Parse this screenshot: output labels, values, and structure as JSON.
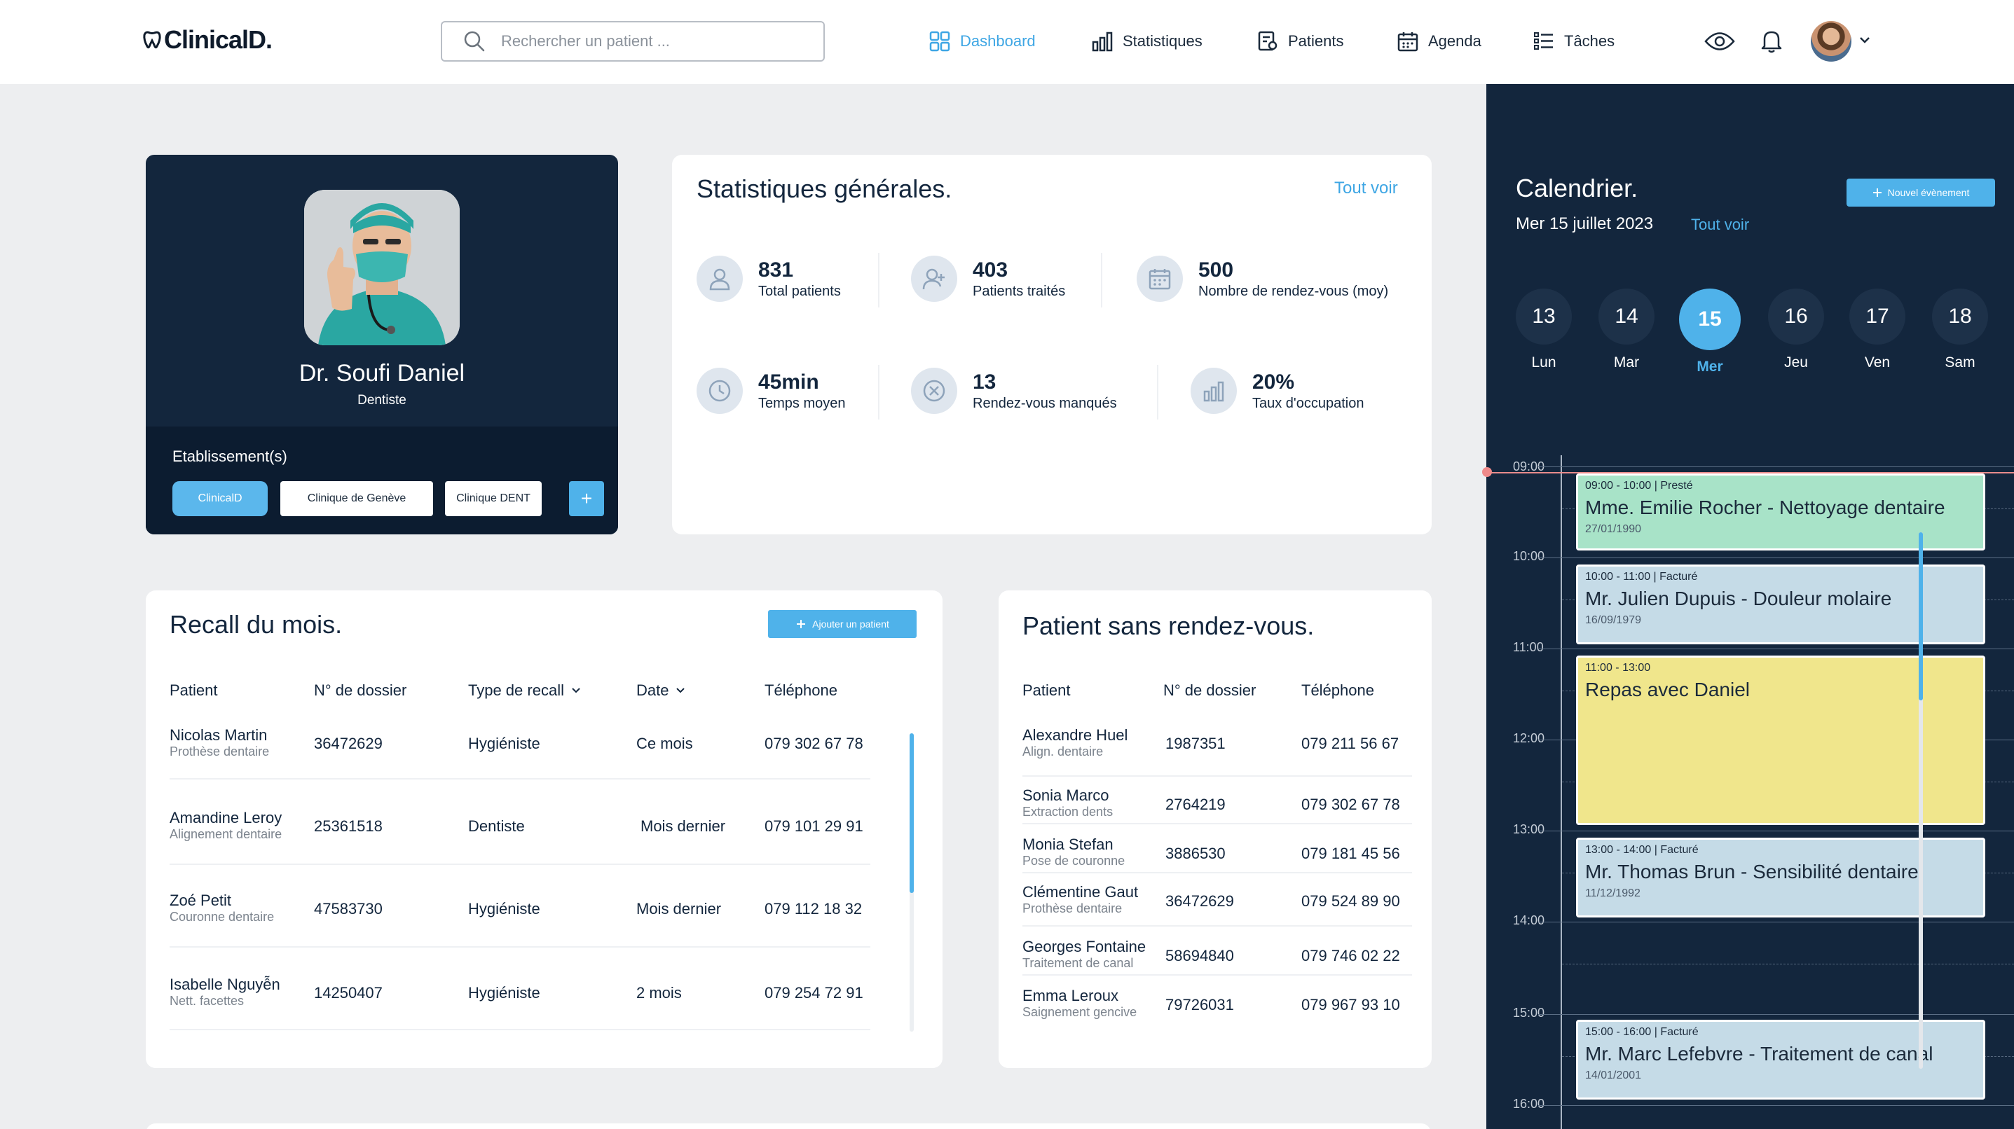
{
  "app": {
    "logo_text": "ClinicalD."
  },
  "search": {
    "placeholder": "Rechercher un patient ..."
  },
  "nav": [
    {
      "label": "Dashboard",
      "icon": "grid-icon",
      "active": true
    },
    {
      "label": "Statistiques",
      "icon": "bar-chart-icon"
    },
    {
      "label": "Patients",
      "icon": "patients-icon"
    },
    {
      "label": "Agenda",
      "icon": "calendar-icon"
    },
    {
      "label": "Tâches",
      "icon": "tasks-icon"
    }
  ],
  "profile": {
    "name": "Dr. Soufi Daniel",
    "role": "Dentiste",
    "establishments_title": "Etablissement(s)",
    "establishments": [
      "ClinicalD",
      "Clinique de Genève",
      "Clinique DENT"
    ],
    "add_label": "+"
  },
  "stats": {
    "title": "Statistiques générales.",
    "see_all": "Tout voir",
    "items": [
      {
        "value": "831",
        "label": "Total patients",
        "icon": "user-icon"
      },
      {
        "value": "403",
        "label": "Patients traités",
        "icon": "user-add-icon"
      },
      {
        "value": "500",
        "label": "Nombre de rendez-vous (moy)",
        "icon": "calendar-icon"
      },
      {
        "value": "45min",
        "label": "Temps moyen",
        "icon": "clock-icon"
      },
      {
        "value": "13",
        "label": "Rendez-vous manqués",
        "icon": "x-circle-icon"
      },
      {
        "value": "20%",
        "label": "Taux d'occupation",
        "icon": "bar-chart-icon"
      }
    ]
  },
  "recall": {
    "title": "Recall du mois.",
    "add_button": "Ajouter un patient",
    "columns": [
      "Patient",
      "N° de dossier",
      "Type de recall",
      "Date",
      "Téléphone"
    ],
    "rows": [
      {
        "name": "Nicolas Martin",
        "sub": "Prothèse dentaire",
        "dossier": "36472629",
        "type": "Hygiéniste",
        "date": "Ce mois",
        "phone": "079 302 67 78"
      },
      {
        "name": "Amandine Leroy",
        "sub": "Alignement dentaire",
        "dossier": "25361518",
        "type": "Dentiste",
        "date": "Mois dernier",
        "phone": "079 101 29 91"
      },
      {
        "name": "Zoé Petit",
        "sub": "Couronne dentaire",
        "dossier": "47583730",
        "type": "Hygiéniste",
        "date": "Mois dernier",
        "phone": "079 112 18 32"
      },
      {
        "name": "Isabelle Nguyễn",
        "sub": "Nett. facettes",
        "dossier": "14250407",
        "type": "Hygiéniste",
        "date": "2 mois",
        "phone": "079 254 72 91"
      }
    ]
  },
  "no_appointment": {
    "title": "Patient sans rendez-vous.",
    "columns": [
      "Patient",
      "N° de dossier",
      "Téléphone"
    ],
    "rows": [
      {
        "name": "Alexandre Huel",
        "sub": "Align. dentaire",
        "dossier": "1987351",
        "phone": "079 211 56 67"
      },
      {
        "name": "Sonia Marco",
        "sub": "Extraction dents",
        "dossier": "2764219",
        "phone": "079 302 67 78"
      },
      {
        "name": "Monia Stefan",
        "sub": "Pose de couronne",
        "dossier": "3886530",
        "phone": "079 181 45 56"
      },
      {
        "name": "Clémentine  Gaut",
        "sub": "Prothèse dentaire",
        "dossier": "36472629",
        "phone": "079 524 89 90"
      },
      {
        "name": "Georges Fontaine",
        "sub": "Traitement de canal",
        "dossier": "58694840",
        "phone": "079 746 02 22"
      },
      {
        "name": "Emma Leroux",
        "sub": "Saignement gencive",
        "dossier": "79726031",
        "phone": "079 967 93 10"
      }
    ]
  },
  "calendar": {
    "title": "Calendrier.",
    "date": "Mer 15 juillet 2023",
    "see_all": "Tout voir",
    "new_event": "Nouvel évènement",
    "days": [
      {
        "num": "13",
        "label": "Lun"
      },
      {
        "num": "14",
        "label": "Mar"
      },
      {
        "num": "15",
        "label": "Mer",
        "active": true
      },
      {
        "num": "16",
        "label": "Jeu"
      },
      {
        "num": "17",
        "label": "Ven"
      },
      {
        "num": "18",
        "label": "Sam"
      }
    ],
    "hours": [
      "09:00",
      "10:00",
      "11:00",
      "12:00",
      "13:00",
      "14:00",
      "15:00",
      "16:00"
    ],
    "events": [
      {
        "time": "09:00 - 10:00 | Presté",
        "title": "Mme. Emilie Rocher - Nettoyage dentaire",
        "date": "27/01/1990",
        "color": "#a8e3c8"
      },
      {
        "time": "10:00 - 11:00 | Facturé",
        "title": "Mr. Julien Dupuis - Douleur molaire",
        "date": "16/09/1979",
        "color": "#c5dbe7"
      },
      {
        "time": "11:00 - 13:00",
        "title": "Repas avec Daniel",
        "date": "",
        "color": "#f0e68c"
      },
      {
        "time": "13:00 - 14:00 | Facturé",
        "title": "Mr. Thomas Brun - Sensibilité dentaire",
        "date": "11/12/1992",
        "color": "#c5dbe7"
      },
      {
        "time": "15:00 - 16:00 | Facturé",
        "title": "Mr. Marc Lefebvre - Traitement de canal",
        "date": "14/01/2001",
        "color": "#c5dbe7"
      }
    ]
  },
  "colors": {
    "accent": "#4fb2ea",
    "navy": "#13263d",
    "background": "#edeef0"
  }
}
